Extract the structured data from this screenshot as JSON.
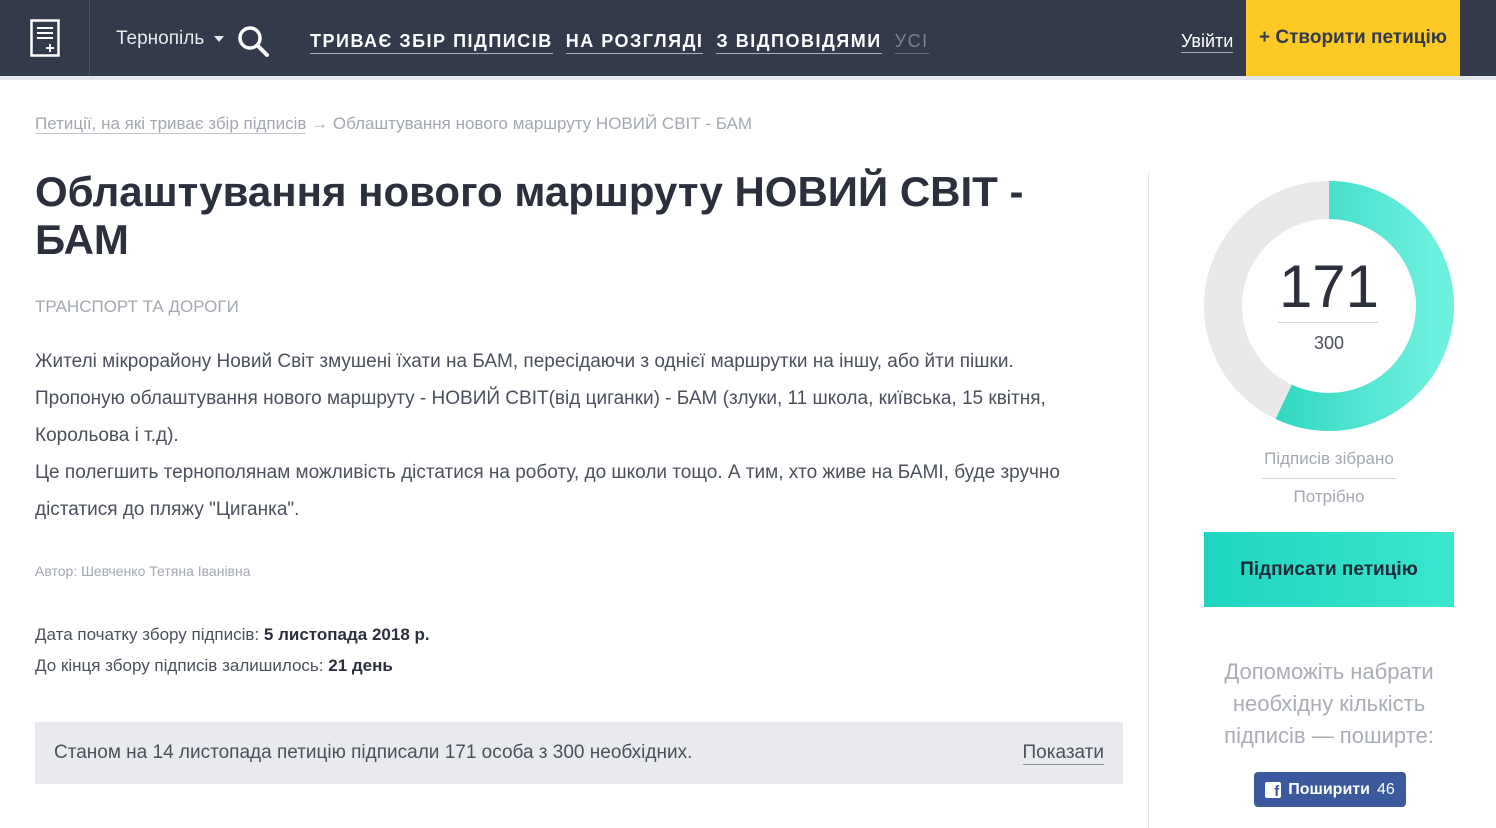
{
  "header": {
    "city": "Тернопіль",
    "nav": [
      {
        "label": "ТРИВАЄ ЗБІР ПІДПИСІВ"
      },
      {
        "label": "НА РОЗГЛЯДІ"
      },
      {
        "label": "З ВІДПОВІДЯМИ"
      },
      {
        "label": "УСІ"
      }
    ],
    "login": "Увійти",
    "create": "+ Створити петицію"
  },
  "breadcrumb": {
    "parent": "Петиції, на які триває збір підписів",
    "separator": "→",
    "current": "Облаштування нового маршруту НОВИЙ СВІТ - БАМ"
  },
  "petition": {
    "title": "Облаштування нового маршруту НОВИЙ СВІТ - БАМ",
    "category": "ТРАНСПОРТ ТА ДОРОГИ",
    "paragraphs": [
      "Жителі мікрорайону Новий Світ змушені їхати на БАМ, пересідаючи з однієї маршрутки на іншу, або йти пішки.",
      "Пропоную облаштування нового маршруту - НОВИЙ СВІТ(від циганки) - БАМ (злуки, 11 школа, київська, 15 квітня, Корольова і т.д).",
      "Це полегшить тернополянам можливість дістатися на роботу, до школи тощо. А тим, хто живе на БАМІ, буде зручно дістатися до пляжу \"Циганка\"."
    ],
    "author": "Автор: Шевченко Тетяна Іванівна",
    "start_label": "Дата початку збору підписів:",
    "start_value": "5 листопада 2018 р.",
    "remaining_label": "До кінця збору підписів залишилось:",
    "remaining_value": "21 день",
    "status_text": "Станом на 14 листопада петицію підписали 171 особа з 300 необхідних.",
    "show_label": "Показати"
  },
  "sidebar": {
    "collected": "171",
    "required": "300",
    "progress": 0.57,
    "collected_label": "Підписів зібрано",
    "required_label": "Потрібно",
    "sign_button": "Підписати петицію",
    "help_text": "Допоможіть набрати необхідну кількість підписів — поширте:",
    "share_label": "Поширити",
    "share_count": "46",
    "colors": {
      "accent": "#1fd5c1",
      "track": "#e9e9e9",
      "header": "#323a4b",
      "cta": "#fcc925",
      "facebook": "#3b5a9d"
    }
  }
}
